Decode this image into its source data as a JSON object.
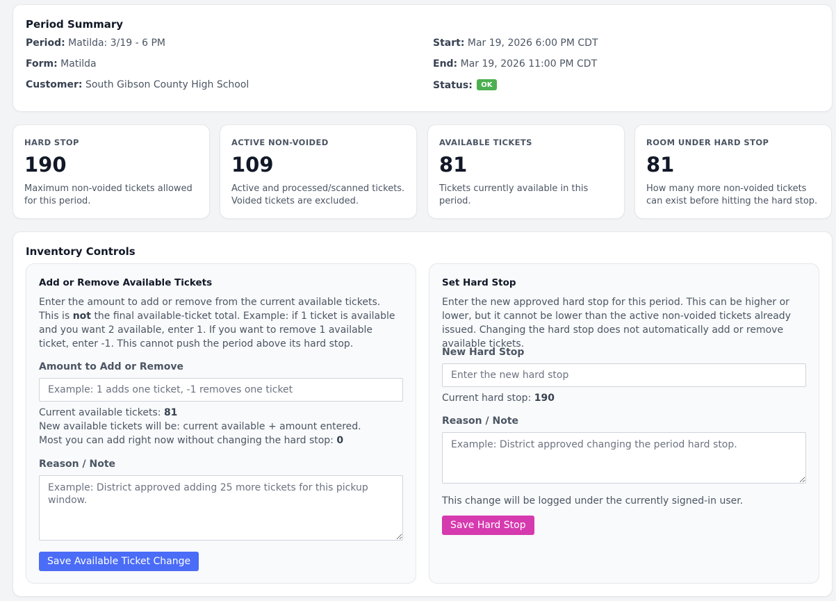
{
  "summary": {
    "title": "Period Summary",
    "period_label": "Period:",
    "period_value": "Matilda: 3/19 - 6 PM",
    "form_label": "Form:",
    "form_value": "Matilda",
    "customer_label": "Customer:",
    "customer_value": "South Gibson County High School",
    "start_label": "Start:",
    "start_value": "Mar 19, 2026 6:00 PM CDT",
    "end_label": "End:",
    "end_value": "Mar 19, 2026 11:00 PM CDT",
    "status_label": "Status:",
    "status_value": "OK",
    "status_color": "#4caf50"
  },
  "stats": [
    {
      "label": "HARD STOP",
      "value": "190",
      "desc": "Maximum non-voided tickets allowed for this period."
    },
    {
      "label": "ACTIVE NON-VOIDED",
      "value": "109",
      "desc": "Active and processed/scanned tickets. Voided tickets are excluded."
    },
    {
      "label": "AVAILABLE TICKETS",
      "value": "81",
      "desc": "Tickets currently available in this period."
    },
    {
      "label": "ROOM UNDER HARD STOP",
      "value": "81",
      "desc": "How many more non-voided tickets can exist before hitting the hard stop."
    }
  ],
  "inventory": {
    "title": "Inventory Controls",
    "add_remove": {
      "title": "Add or Remove Available Tickets",
      "desc_part1": "Enter the amount to add or remove from the current available tickets. This is",
      "desc_bold": "not",
      "desc_part2": "the final available-ticket total. Example: if 1 ticket is available and you want 2 available, enter 1. If you want to remove 1 available ticket, enter -1. This cannot push the period above its hard stop.",
      "amount_label": "Amount to Add or Remove",
      "amount_placeholder": "Example: 1 adds one ticket, -1 removes one ticket",
      "current_available_label": "Current available tickets:",
      "current_available_value": "81",
      "new_available_text": "New available tickets will be: current available + amount entered.",
      "most_add_label": "Most you can add right now without changing the hard stop:",
      "most_add_value": "0",
      "reason_label": "Reason / Note",
      "reason_placeholder": "Example: District approved adding 25 more tickets for this pickup window.",
      "save_label": "Save Available Ticket Change",
      "save_color": "#4a6cf7"
    },
    "hard_stop": {
      "title": "Set Hard Stop",
      "desc": "Enter the new approved hard stop for this period. This can be higher or lower, but it cannot be lower than the active non-voided tickets already issued. Changing the hard stop does not automatically add or remove available tickets.",
      "new_label": "New Hard Stop",
      "new_placeholder": "Enter the new hard stop",
      "current_label": "Current hard stop:",
      "current_value": "190",
      "reason_label": "Reason / Note",
      "reason_placeholder": "Example: District approved changing the period hard stop.",
      "log_note": "This change will be logged under the currently signed-in user.",
      "save_label": "Save Hard Stop",
      "save_color": "#d63aaf"
    }
  }
}
